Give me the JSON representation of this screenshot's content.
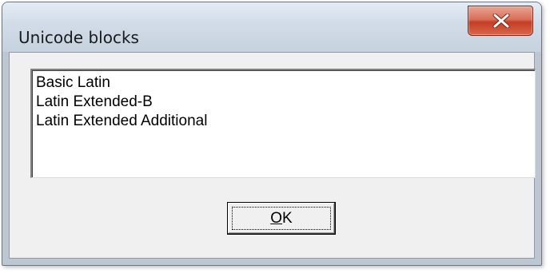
{
  "dialog": {
    "title": "Unicode blocks",
    "close_icon": "close-x-icon",
    "list_items": [
      "Basic Latin",
      "Latin Extended-B",
      "Latin Extended Additional"
    ],
    "ok_button": {
      "mnemonic": "O",
      "rest": "K"
    }
  },
  "colors": {
    "close_button": "#c43d25",
    "title_bar": "#d3dde9",
    "client_background": "#f0f0f0"
  }
}
